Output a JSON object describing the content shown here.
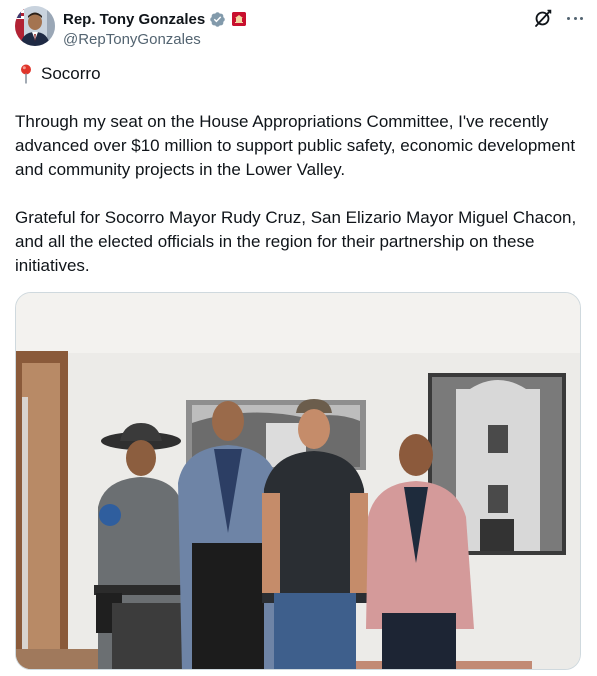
{
  "author": {
    "display_name": "Rep. Tony Gonzales",
    "handle": "@RepTonyGonzales",
    "verified": true,
    "avatar_icon": "avatar-photo",
    "affiliation_badge_icon": "us-house-badge-icon"
  },
  "actions": {
    "grok_icon": "grok-icon",
    "more_icon": "more-icon"
  },
  "tweet": {
    "location_icon": "round-pushpin-icon",
    "location": "Socorro",
    "paragraph_1": "Through my seat on the House Appropriations Committee, I've recently advanced over $10 million to support public safety, economic development and community projects in the Lower Valley.",
    "paragraph_2": "Grateful for Socorro Mayor Rudy Cruz, San Elizario Mayor Miguel Chacon, and all the elected officials in the region for their partnership on these initiatives."
  },
  "media": {
    "type": "photo",
    "subject": "four-men-standing-photo"
  },
  "colors": {
    "text": "#0f1419",
    "secondary_text": "#536471",
    "verified_blue": "#1d9bf0",
    "border": "#cfd9de"
  }
}
